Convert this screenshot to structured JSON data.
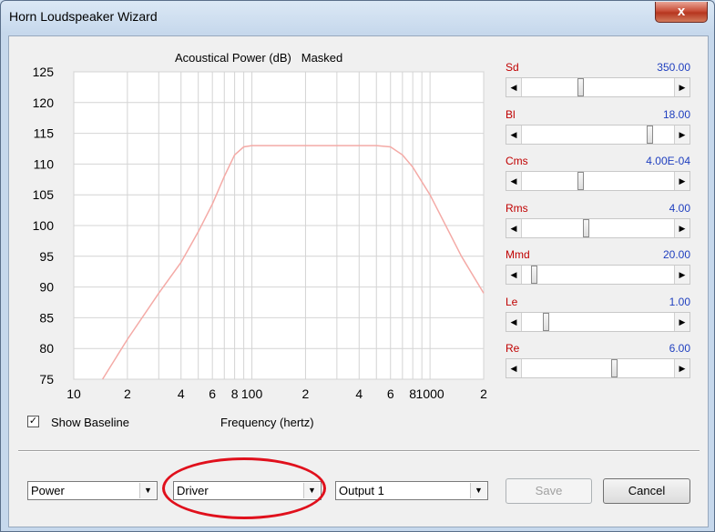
{
  "window": {
    "title": "Horn Loudspeaker Wizard",
    "close_glyph": "x"
  },
  "chart_title_left": "Acoustical Power (dB)",
  "chart_title_right": "Masked",
  "chart_data": {
    "type": "line",
    "title": "Acoustical Power (dB)   Masked",
    "xlabel": "Frequency (hertz)",
    "ylabel": "",
    "xscale": "log",
    "xlim": [
      10,
      2000
    ],
    "ylim": [
      75,
      125
    ],
    "yticks": [
      75,
      80,
      85,
      90,
      95,
      100,
      105,
      110,
      115,
      120,
      125
    ],
    "xtick_labels": [
      {
        "v": 10,
        "t": "10"
      },
      {
        "v": 20,
        "t": "2"
      },
      {
        "v": 40,
        "t": "4"
      },
      {
        "v": 60,
        "t": "6"
      },
      {
        "v": 80,
        "t": "8"
      },
      {
        "v": 100,
        "t": "100"
      },
      {
        "v": 200,
        "t": "2"
      },
      {
        "v": 400,
        "t": "4"
      },
      {
        "v": 600,
        "t": "6"
      },
      {
        "v": 800,
        "t": "8"
      },
      {
        "v": 1000,
        "t": "1000"
      },
      {
        "v": 2000,
        "t": "2"
      }
    ],
    "grid": true,
    "line_color": "#f4aaa6",
    "series": [
      {
        "x": [
          14.5,
          20,
          30,
          40,
          50,
          60,
          70,
          80,
          90,
          100,
          200,
          300,
          500,
          600,
          700,
          800,
          1000,
          1500,
          2000
        ],
        "y": [
          75,
          81.5,
          89,
          94,
          99,
          103.5,
          108,
          111.5,
          112.8,
          113,
          113,
          113,
          113,
          112.8,
          111.5,
          109.5,
          105,
          95,
          89
        ]
      }
    ]
  },
  "params": [
    {
      "label": "Sd",
      "value": "350.00",
      "pos": 0.38
    },
    {
      "label": "Bl",
      "value": "18.00",
      "pos": 0.85
    },
    {
      "label": "Cms",
      "value": "4.00E-04",
      "pos": 0.38
    },
    {
      "label": "Rms",
      "value": "4.00",
      "pos": 0.42
    },
    {
      "label": "Mmd",
      "value": "20.00",
      "pos": 0.07
    },
    {
      "label": "Le",
      "value": "1.00",
      "pos": 0.15
    },
    {
      "label": "Re",
      "value": "6.00",
      "pos": 0.61
    }
  ],
  "show_baseline": {
    "label": "Show Baseline",
    "checked": true,
    "mark": "✓"
  },
  "xaxis_label": "Frequency (hertz)",
  "combos": {
    "plot": "Power",
    "source": "Driver",
    "output": "Output 1",
    "arrow": "▼"
  },
  "buttons": {
    "save": "Save",
    "cancel": "Cancel"
  },
  "arrows": {
    "left": "◀",
    "right": "▶"
  },
  "colors": {
    "param_label": "#c00000",
    "param_value": "#1f3fbf",
    "highlight": "#e0101c"
  }
}
